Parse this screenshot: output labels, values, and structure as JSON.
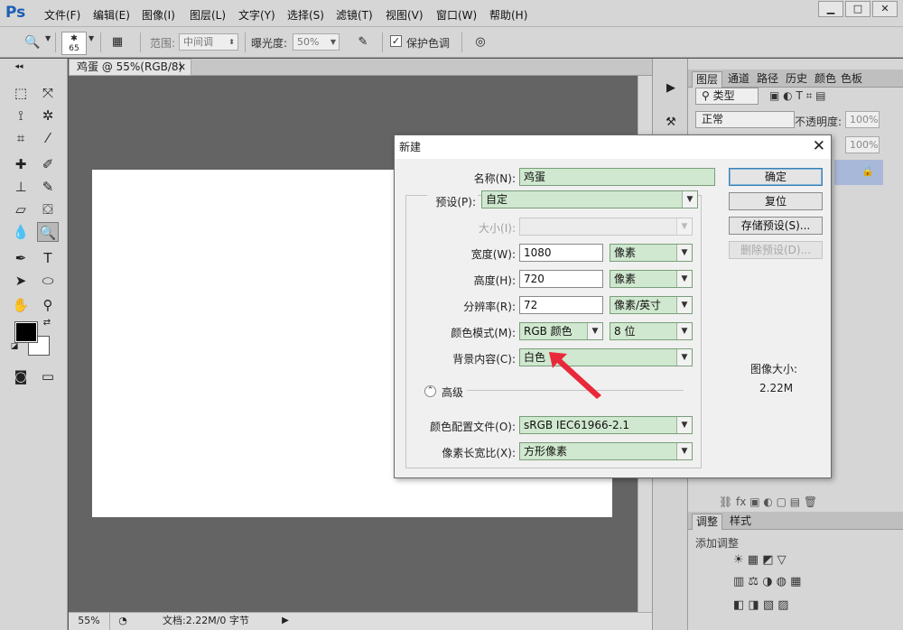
{
  "menubar": {
    "logo": "Ps",
    "items": [
      "文件(F)",
      "编辑(E)",
      "图像(I)",
      "图层(L)",
      "文字(Y)",
      "选择(S)",
      "滤镜(T)",
      "视图(V)",
      "窗口(W)",
      "帮助(H)"
    ]
  },
  "options": {
    "brush_size": "65",
    "range_label": "范围:",
    "range_value": "中间调",
    "exposure_label": "曝光度:",
    "exposure_value": "50%",
    "protect_tones_label": "保护色调"
  },
  "document": {
    "tab_title": "鸡蛋 @ 55%(RGB/8)",
    "zoom": "55%",
    "doc_info": "文档:2.22M/0 字节"
  },
  "panels": {
    "top_tabs": [
      "图层",
      "通道",
      "路径",
      "历史",
      "颜色",
      "色板"
    ],
    "kind_label": "类型",
    "blend_mode": "正常",
    "opacity_label": "不透明度:",
    "opacity_value": "100%",
    "fill_value": "100%",
    "adjust_tabs": [
      "调整",
      "样式"
    ],
    "add_adjustment": "添加调整"
  },
  "dialog": {
    "title": "新建",
    "name_label": "名称(N):",
    "name_value": "鸡蛋",
    "preset_label": "预设(P):",
    "preset_value": "自定",
    "size_label": "大小(I):",
    "width_label": "宽度(W):",
    "width_value": "1080",
    "width_unit": "像素",
    "height_label": "高度(H):",
    "height_value": "720",
    "height_unit": "像素",
    "resolution_label": "分辨率(R):",
    "resolution_value": "72",
    "resolution_unit": "像素/英寸",
    "color_mode_label": "颜色模式(M):",
    "color_mode_value": "RGB 颜色",
    "bit_depth": "8 位",
    "background_label": "背景内容(C):",
    "background_value": "白色",
    "advanced_label": "高级",
    "color_profile_label": "颜色配置文件(O):",
    "color_profile_value": "sRGB IEC61966-2.1",
    "pixel_aspect_label": "像素长宽比(X):",
    "pixel_aspect_value": "方形像素",
    "btn_ok": "确定",
    "btn_reset": "复位",
    "btn_save_preset": "存储预设(S)...",
    "btn_delete_preset": "删除预设(D)...",
    "image_size_label": "图像大小:",
    "image_size_value": "2.22M"
  },
  "colors": {
    "field_green": "#cfe8cf",
    "arrow_red": "#e8293a",
    "ps_blue": "#1d5fb4"
  }
}
